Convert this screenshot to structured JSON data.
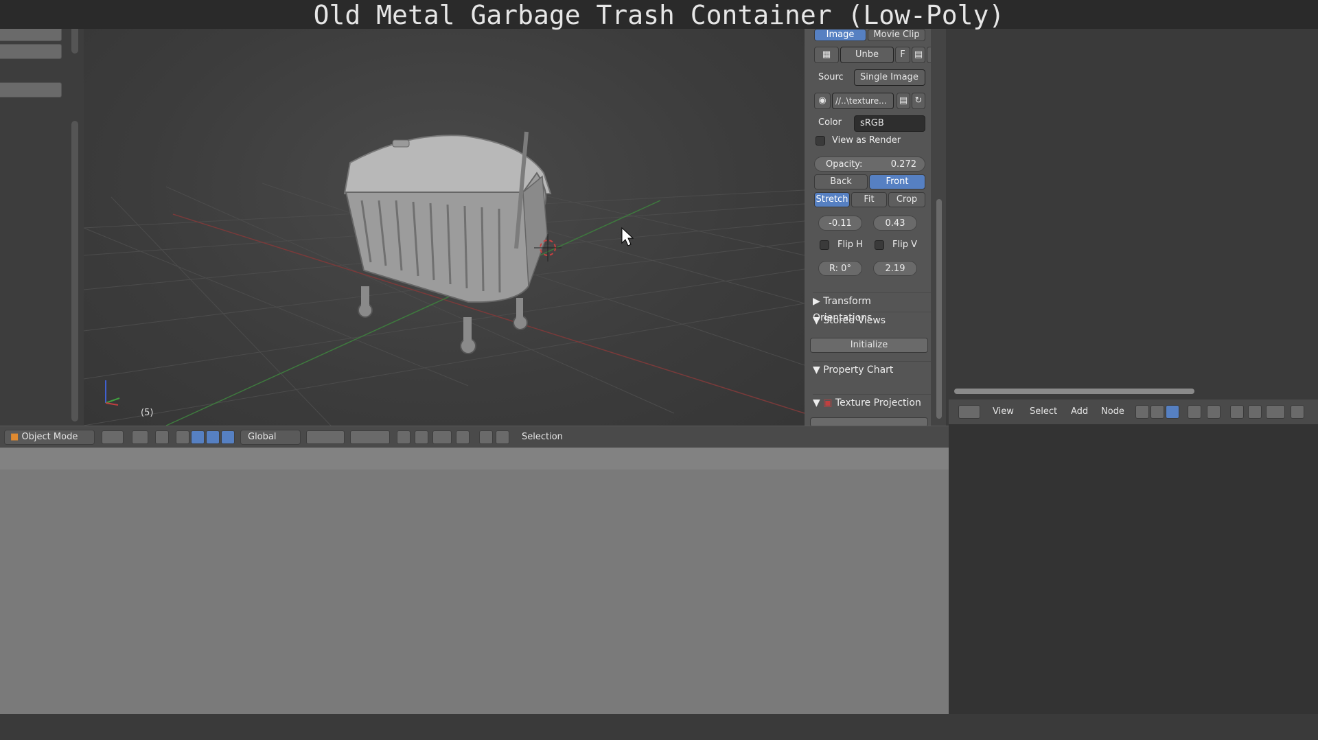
{
  "window_title": "Old Metal Garbage Trash Container (Low-Poly)",
  "viewport": {
    "frame_label": "(5)"
  },
  "image_panel": {
    "tabs": [
      {
        "label": "Image",
        "active": true
      },
      {
        "label": "Movie Clip",
        "active": false
      }
    ],
    "image_name": "Unbe",
    "fake_user_label": "F",
    "source_label": "Sourc",
    "source_value": "Single Image",
    "filepath": "//..\\texture...",
    "color_label": "Color",
    "color_value": "sRGB",
    "view_as_render_label": "View as Render",
    "opacity_label": "Opacity:",
    "opacity_value": "0.272",
    "side_buttons": [
      {
        "label": "Back",
        "active": false
      },
      {
        "label": "Front",
        "active": true
      }
    ],
    "frame_method": [
      {
        "label": "Stretch",
        "active": true
      },
      {
        "label": "Fit",
        "active": false
      },
      {
        "label": "Crop",
        "active": false
      }
    ],
    "offset_x": "-0.11",
    "offset_y": "0.43",
    "flip_h_label": "Flip H",
    "flip_v_label": "Flip V",
    "rotation": "R: 0°",
    "size": "2.19"
  },
  "panels": {
    "transform_orientations": "Transform Orientations",
    "stored_views": "Stored Views",
    "initialize_button": "Initialize",
    "property_chart": "Property Chart",
    "texture_projection": "Texture Projection"
  },
  "viewport_toolbar": {
    "mode": "Object Mode",
    "orientation": "Global",
    "selection_label": "Selection"
  },
  "node_editor_toolbar": {
    "menus": [
      "View",
      "Select",
      "Add",
      "Node"
    ]
  },
  "colors": {
    "accent_blue": "#5680c2",
    "panel_bg": "#555555",
    "viewport_bg": "#3c3c3c"
  }
}
